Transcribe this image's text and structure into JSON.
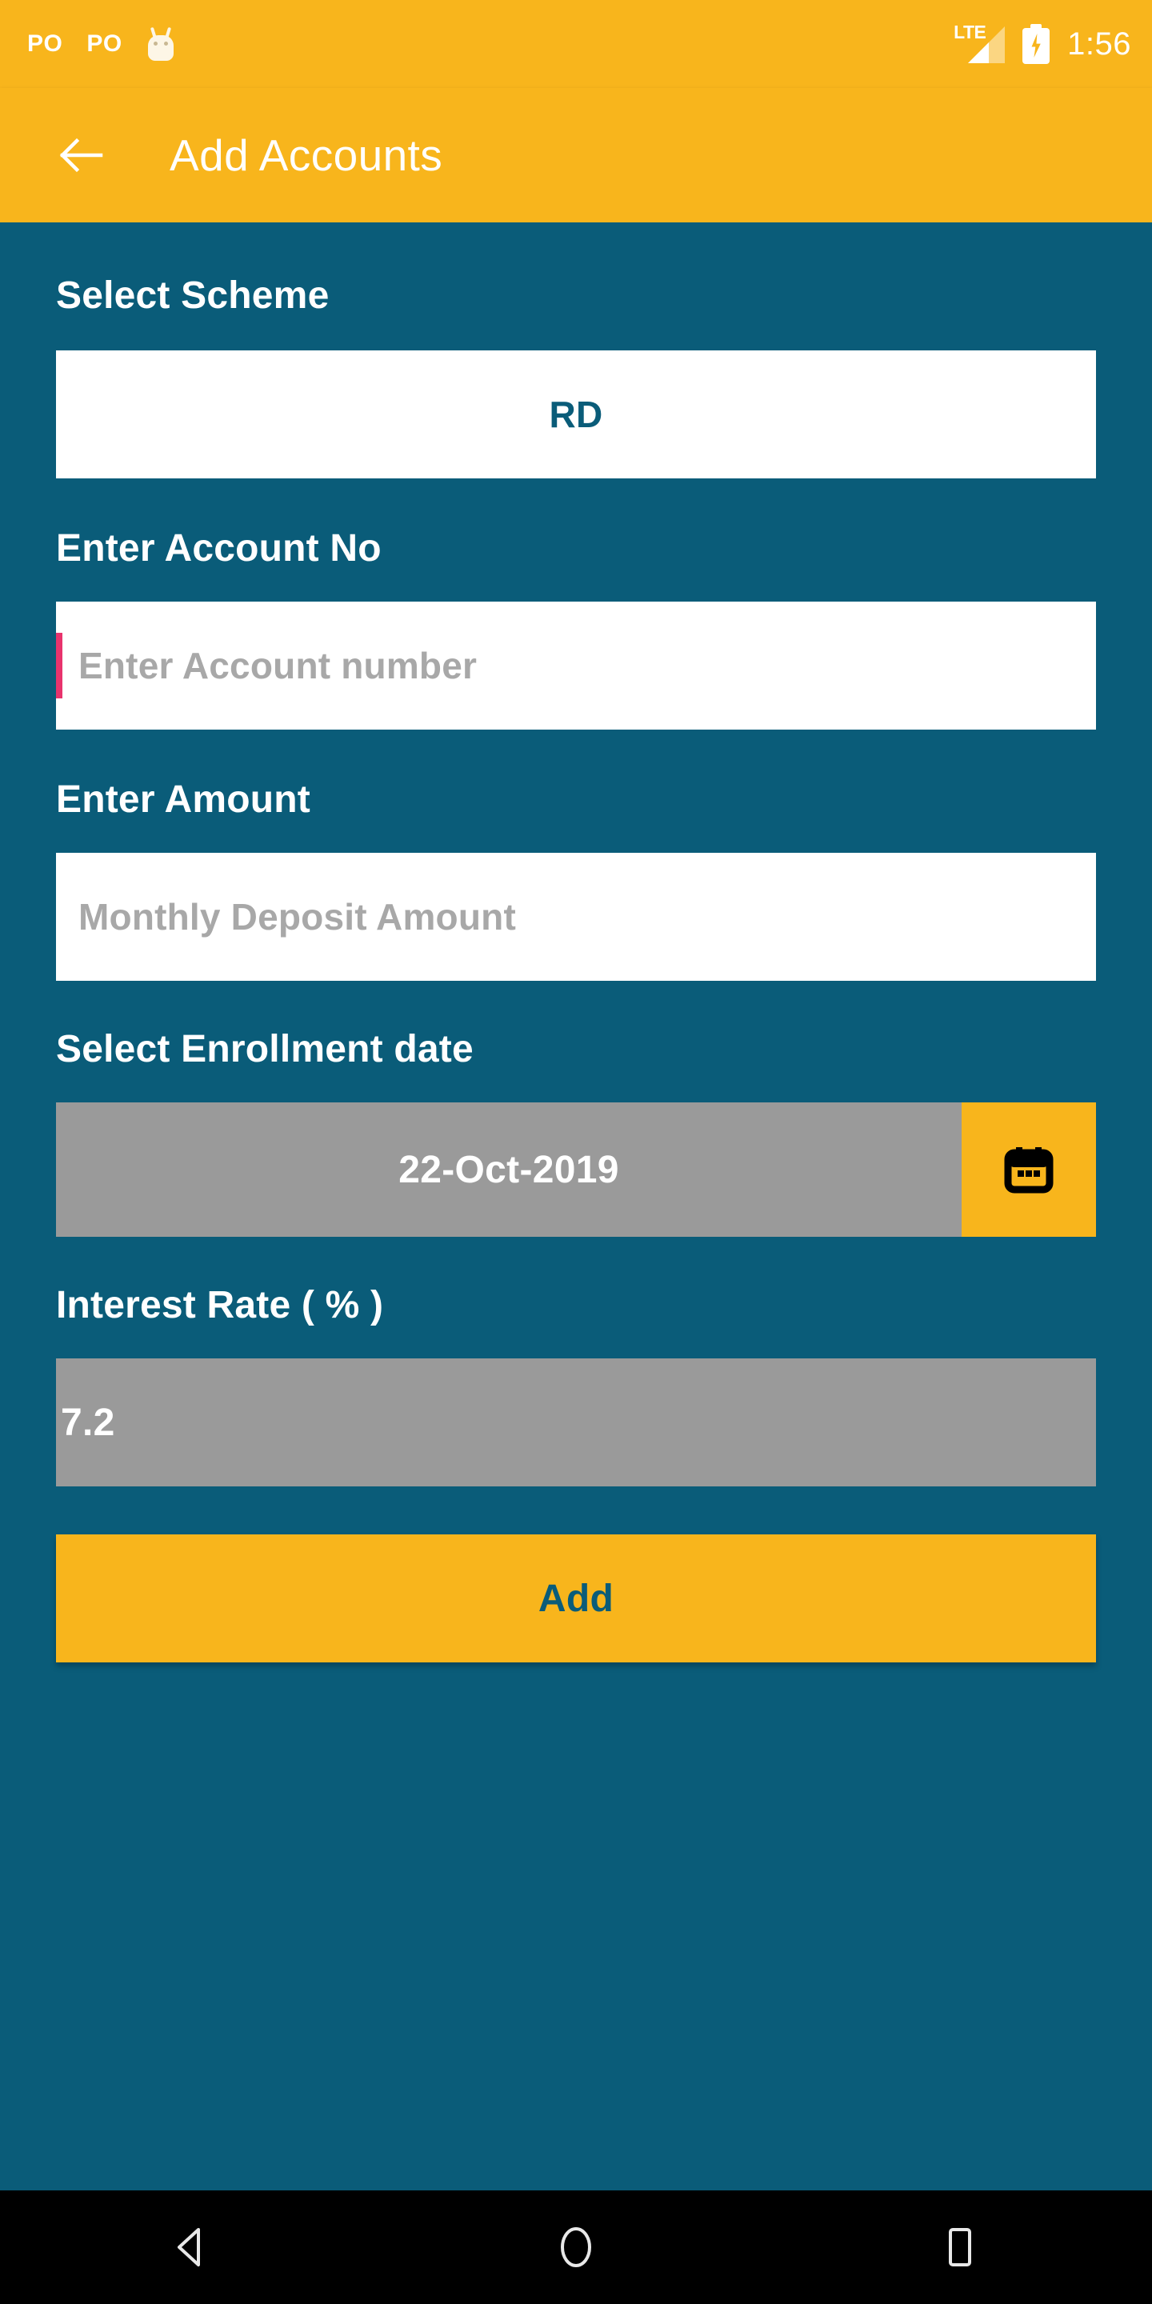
{
  "status_bar": {
    "notifications": [
      {
        "icon": "po-notification-icon",
        "label": "PO"
      },
      {
        "icon": "po-notification-icon",
        "label": "PO"
      },
      {
        "icon": "android-mascot-icon",
        "label": ""
      }
    ],
    "network_label": "LTE",
    "signal_icon": "signal-bars-icon",
    "battery_icon": "battery-charging-icon",
    "time": "1:56"
  },
  "app_bar": {
    "back_icon": "back-arrow-icon",
    "title": "Add Accounts"
  },
  "form": {
    "scheme": {
      "label": "Select Scheme",
      "value": "RD"
    },
    "account_no": {
      "label": "Enter Account No",
      "value": "",
      "placeholder": "Enter Account number",
      "focused": true
    },
    "amount": {
      "label": "Enter Amount",
      "value": "",
      "placeholder": "Monthly Deposit Amount",
      "focused": false
    },
    "enrollment_date": {
      "label": "Select Enrollment date",
      "value": "22-Oct-2019",
      "calendar_icon": "calendar-icon"
    },
    "interest_rate": {
      "label": "Interest Rate ( % )",
      "value": "7.2"
    },
    "submit": {
      "label": "Add"
    }
  },
  "nav_bar": {
    "back_icon": "nav-back-triangle-icon",
    "home_icon": "nav-home-circle-icon",
    "recents_icon": "nav-recents-square-icon"
  },
  "colors": {
    "accent_amber": "#f8b51c",
    "background_teal": "#0a5c79",
    "disabled_gray": "#9a9a9a",
    "caret_pink": "#e8336d",
    "nav_black": "#000000"
  }
}
